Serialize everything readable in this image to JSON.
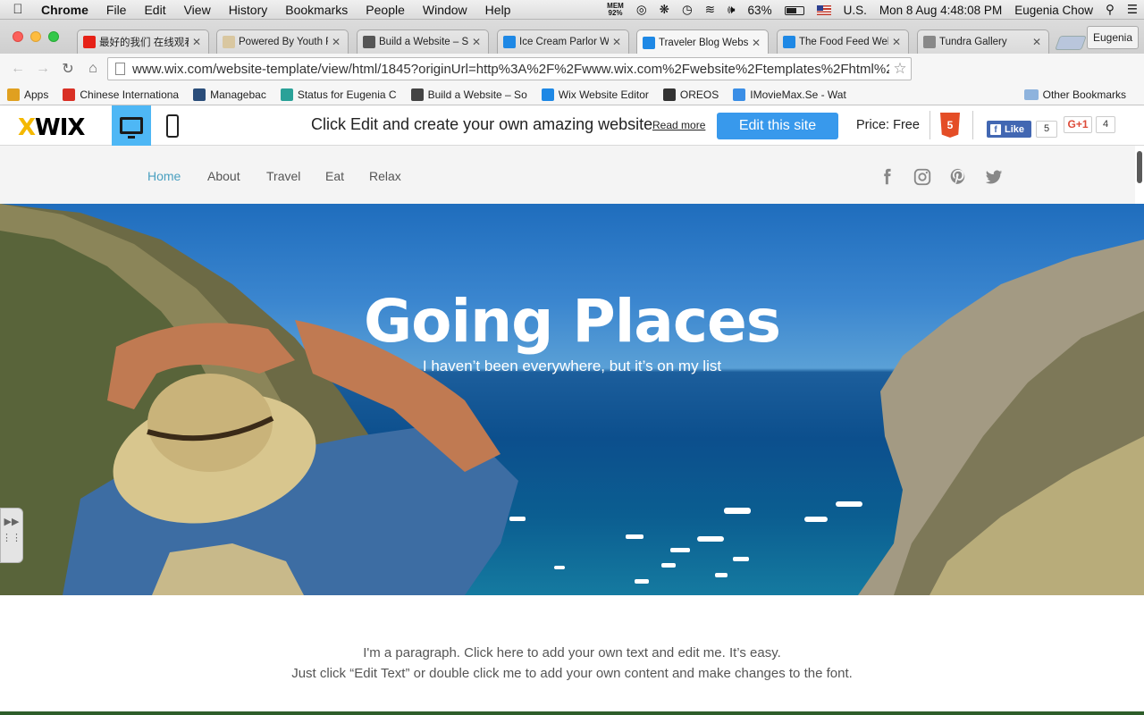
{
  "menubar": {
    "items": [
      "Chrome",
      "File",
      "Edit",
      "View",
      "History",
      "Bookmarks",
      "People",
      "Window",
      "Help"
    ],
    "mem_label": "MEM",
    "mem_value": "92%",
    "battery": "63%",
    "battery_level": 0.63,
    "input_source": "U.S.",
    "datetime": "Mon 8 Aug  4:48:08 PM",
    "user": "Eugenia Chow"
  },
  "tabs": [
    {
      "title": "最好的我们 在线观看",
      "icon": "youtube-icon",
      "color": "#e62117"
    },
    {
      "title": "Powered By Youth F",
      "icon": "page-icon",
      "color": "#d9c7a0"
    },
    {
      "title": "Build a Website – So",
      "icon": "squarespace-icon",
      "color": "#555"
    },
    {
      "title": "Ice Cream Parlor W",
      "icon": "wix-icon",
      "color": "#1e88e5"
    },
    {
      "title": "Traveler Blog Webs",
      "icon": "wix-icon",
      "color": "#1e88e5"
    },
    {
      "title": "The Food Feed Web",
      "icon": "wix-icon",
      "color": "#1e88e5"
    },
    {
      "title": "Tundra Gallery",
      "icon": "page-icon",
      "color": "#888"
    }
  ],
  "active_tab": 4,
  "profile_button": "Eugenia",
  "address_url": "www.wix.com/website-template/view/html/1845?originUrl=http%3A%2F%2Fwww.wix.com%2Fwebsite%2Ftemplates%2Fhtml%2F...",
  "bookmarks": [
    {
      "label": "Apps",
      "icon": "apps-grid-icon",
      "color": "#e0a020"
    },
    {
      "label": "Chinese Internationa",
      "icon": "gmail-icon",
      "color": "#d93025"
    },
    {
      "label": "Managebac",
      "icon": "managebac-icon",
      "color": "#2a4d7a"
    },
    {
      "label": "Status for Eugenia C",
      "icon": "status-icon",
      "color": "#2aa198"
    },
    {
      "label": "Build a Website – So",
      "icon": "squarespace-icon",
      "color": "#444"
    },
    {
      "label": "Wix Website Editor",
      "icon": "wix-icon",
      "color": "#1e88e5"
    },
    {
      "label": "OREOS",
      "icon": "oreos-icon",
      "color": "#333"
    },
    {
      "label": "IMovieMax.Se - Wat",
      "icon": "globe-icon",
      "color": "#3a8ee6"
    }
  ],
  "other_bookmarks": "Other Bookmarks",
  "wixbar": {
    "logo": "WiX",
    "promo": "Click Edit and create your own amazing website",
    "read_more": "Read more",
    "edit_button": "Edit this site",
    "price": "Price: Free",
    "html5": "5",
    "fb_like": "Like",
    "fb_count": "5",
    "gplus": "G+1",
    "gplus_count": "4"
  },
  "site": {
    "nav": [
      "Home",
      "About",
      "Travel",
      "Eat",
      "Relax"
    ],
    "active_nav": "Home",
    "social": [
      "facebook-icon",
      "instagram-icon",
      "pinterest-icon",
      "twitter-icon"
    ],
    "hero_title": "Going Places",
    "hero_subtitle": "I haven’t been everywhere, but it’s on my list",
    "paragraph_line1": "I'm a paragraph. Click here to add your own text and edit me. It’s easy.",
    "paragraph_line2": "Just click “Edit Text” or double click me to add your own content and make changes to the font."
  },
  "colors": {
    "accent_blue": "#3899ec",
    "nav_active": "#4aa0c0",
    "device_active": "#4eb7f5"
  }
}
